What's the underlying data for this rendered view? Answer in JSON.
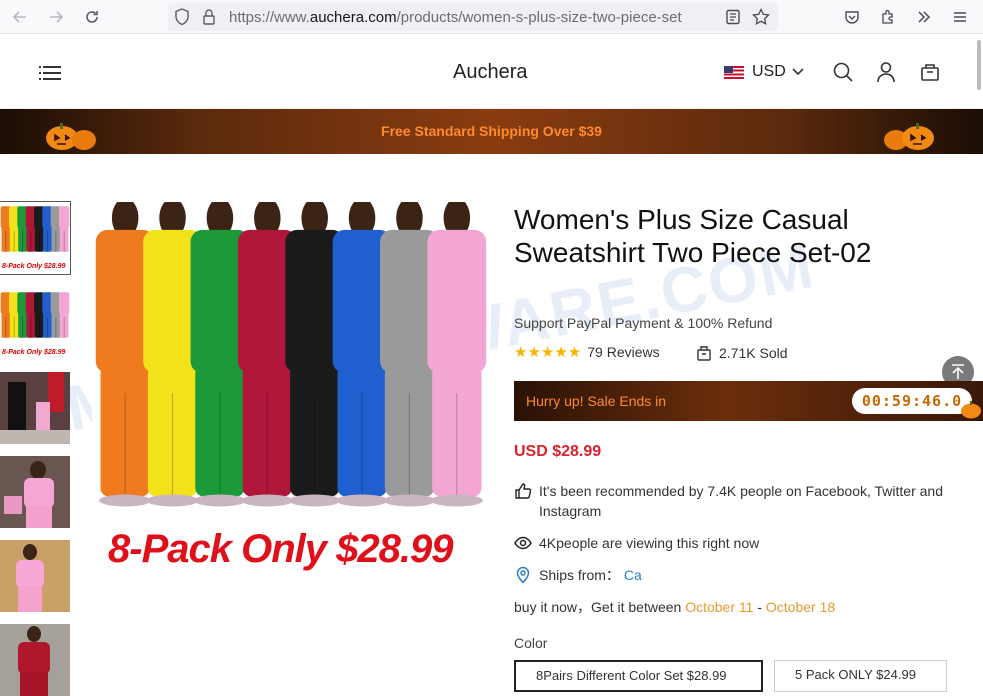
{
  "browser": {
    "url_prefix": "https://www.",
    "url_domain": "auchera.com",
    "url_path": "/products/women-s-plus-size-two-piece-set",
    "icons": [
      "back-arrow-icon",
      "forward-arrow-icon",
      "reload-icon",
      "shield-icon",
      "lock-icon",
      "reader-view-icon",
      "bookmark-star-icon",
      "pocket-icon",
      "extensions-icon",
      "more-tools-icon",
      "hamburger-menu-icon"
    ]
  },
  "header": {
    "logo": "Auchera",
    "currency": "USD"
  },
  "promo": {
    "text": "Free Standard Shipping Over $39"
  },
  "gallery": {
    "thumb_caption": "8-Pack Only $28.99",
    "main_caption": "8-Pack Only $28.99",
    "outfit_colors": [
      "#f07a1e",
      "#f2e21a",
      "#1c9a3a",
      "#b0163a",
      "#1b1b1b",
      "#1f5fd0",
      "#9a9a9a",
      "#f3a6d4"
    ]
  },
  "product": {
    "title": "Women's Plus Size Casual Sweatshirt Two Piece Set-02",
    "support": "Support PayPal Payment & 100% Refund",
    "stars": "★★★★★",
    "reviews": "79 Reviews",
    "sold": "2.71K Sold",
    "sale_text": "Hurry up! Sale Ends in",
    "timer": "00:59:46.0",
    "price": "USD $28.99",
    "recommend": "It's been recommended by 7.4K people on Facebook, Twitter and Instagram",
    "viewing": "4Kpeople are viewing this right now",
    "ships_label": "Ships from：",
    "ships_value": "Ca",
    "buy_prefix": "buy it now，Get it between ",
    "date_from": "October 11",
    "date_sep": " - ",
    "date_to": "October 18",
    "color_label": "Color",
    "options": [
      "8Pairs Different Color Set $28.99",
      "5 Pack ONLY $24.99"
    ]
  },
  "watermark": "MYANTISPYWARE.COM"
}
